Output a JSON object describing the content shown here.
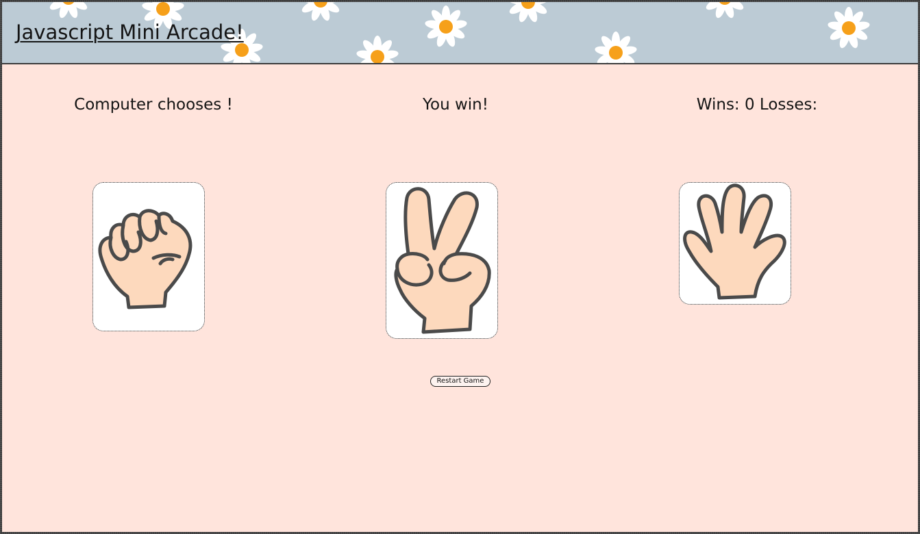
{
  "header": {
    "title": "Javascript Mini Arcade!",
    "background_color": "#bccbd5",
    "decoration": "daisy-pattern"
  },
  "game": {
    "computer_label": "Computer chooses !",
    "result_label": "You win!",
    "score_label": "Wins: 0 Losses:",
    "computer_choice": {
      "name": "rock",
      "icon": "fist-hand-icon"
    },
    "choices": [
      {
        "name": "scissors",
        "icon": "peace-sign-hand-icon"
      },
      {
        "name": "paper",
        "icon": "open-hand-icon"
      }
    ],
    "restart_label": "Restart Game"
  },
  "colors": {
    "page_background": "#ffe4dc",
    "skin": "#fdd9bd",
    "outline": "#4a4a4a",
    "daisy_center": "#f6a01a"
  }
}
